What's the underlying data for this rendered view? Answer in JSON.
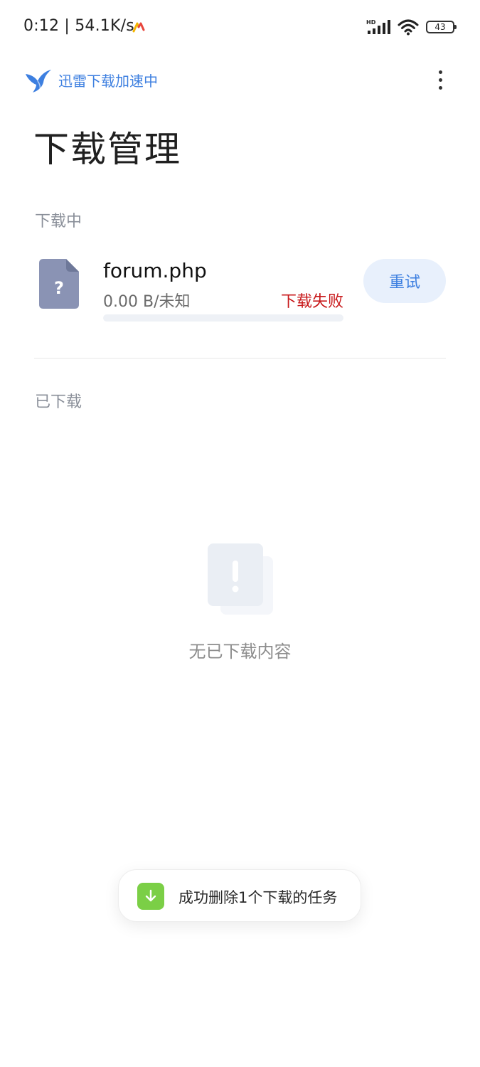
{
  "status_bar": {
    "time_speed": "0:12 | 54.1K/s",
    "battery_level": "43",
    "signal_label": "HD"
  },
  "topbar": {
    "accel_text": "迅雷下载加速中",
    "brand_color": "#3d7fe0"
  },
  "page": {
    "title": "下载管理"
  },
  "downloading": {
    "label": "下载中",
    "items": [
      {
        "file_icon_glyph": "?",
        "name": "forum.php",
        "size": "0.00 B/未知",
        "status": "下载失败",
        "status_color": "#c8191b",
        "progress": 0,
        "action_label": "重试"
      }
    ]
  },
  "downloaded": {
    "label": "已下载",
    "empty_text": "无已下载内容"
  },
  "toast": {
    "text": "成功删除1个下载的任务",
    "icon": "download-arrow-icon"
  }
}
